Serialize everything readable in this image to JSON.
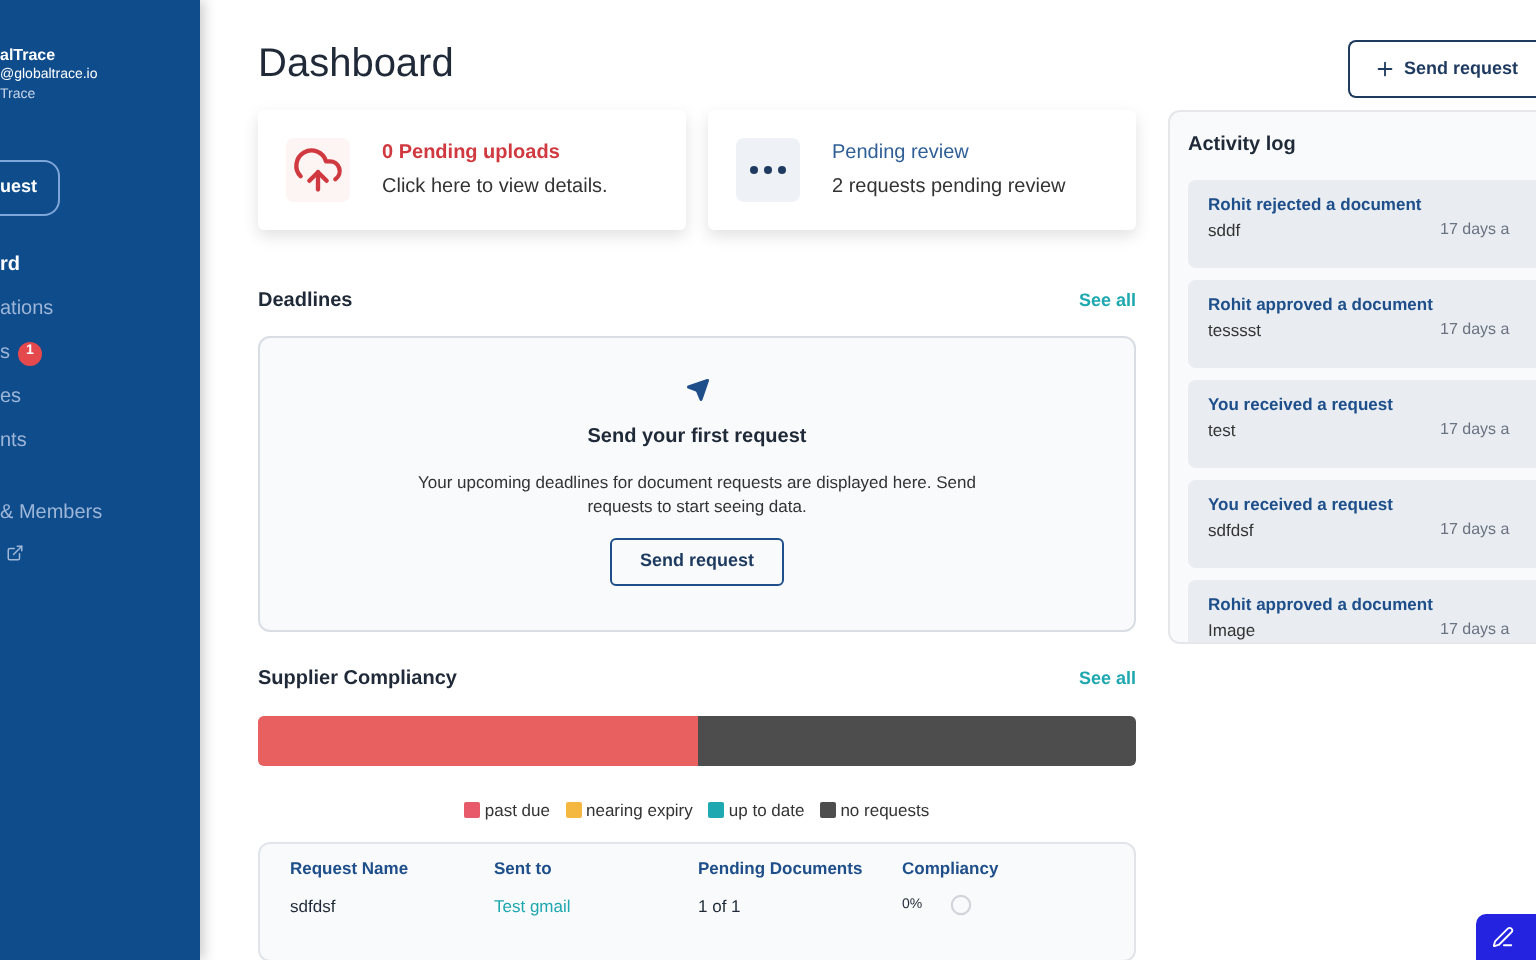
{
  "sidebar": {
    "account": {
      "name": "alTrace",
      "email": "@globaltrace.io",
      "org": "Trace"
    },
    "action_button": "uest",
    "items": [
      {
        "label": "rd",
        "selected": true
      },
      {
        "label": "ations",
        "selected": false
      },
      {
        "label": "s",
        "selected": false,
        "badge": "1"
      },
      {
        "label": "es",
        "selected": false
      },
      {
        "label": "nts",
        "selected": false
      },
      {
        "label": "& Members",
        "selected": false
      }
    ]
  },
  "header": {
    "title": "Dashboard",
    "button": "Send request"
  },
  "summary_cards": [
    {
      "kind": "uploads",
      "title": "0 Pending uploads",
      "text": "Click here to view details."
    },
    {
      "kind": "review",
      "title": "Pending review",
      "text": "2 requests pending review"
    }
  ],
  "deadlines": {
    "title": "Deadlines",
    "link": "See all",
    "empty_title": "Send your first request",
    "empty_text": "Your upcoming deadlines for document requests are displayed here. Send requests to start seeing data.",
    "button": "Send request"
  },
  "compliancy": {
    "title": "Supplier Compliancy",
    "link": "See all",
    "segments": [
      {
        "level": 0.5,
        "color": "#e86060"
      },
      {
        "level": 0.5,
        "color": "#4d4d4d"
      }
    ],
    "legend": [
      {
        "label": "past due",
        "color": "#e85a6a"
      },
      {
        "label": "nearing expiry",
        "color": "#f4b740"
      },
      {
        "label": "up to date",
        "color": "#1fa8b0"
      },
      {
        "label": "no requests",
        "color": "#4d4d4d"
      }
    ],
    "table": {
      "columns": [
        "Request Name",
        "Sent to",
        "Pending Documents",
        "Compliancy"
      ],
      "rows": [
        {
          "name": "sdfdsf",
          "sent_to": "Test gmail",
          "pending": "1 of 1",
          "compliancy": "0%",
          "level": 0
        }
      ]
    }
  },
  "activity_log": {
    "title": "Activity log",
    "entries": [
      {
        "title": "Rohit rejected a document",
        "detail": "sddf",
        "time": "17 days a"
      },
      {
        "title": "Rohit approved a document",
        "detail": "tesssst",
        "time": "17 days a"
      },
      {
        "title": "You received a request",
        "detail": "test",
        "time": "17 days a"
      },
      {
        "title": "You received a request",
        "detail": "sdfdsf",
        "time": "17 days a"
      },
      {
        "title": "Rohit approved a document",
        "detail": "Image",
        "time": "17 days a"
      }
    ]
  }
}
